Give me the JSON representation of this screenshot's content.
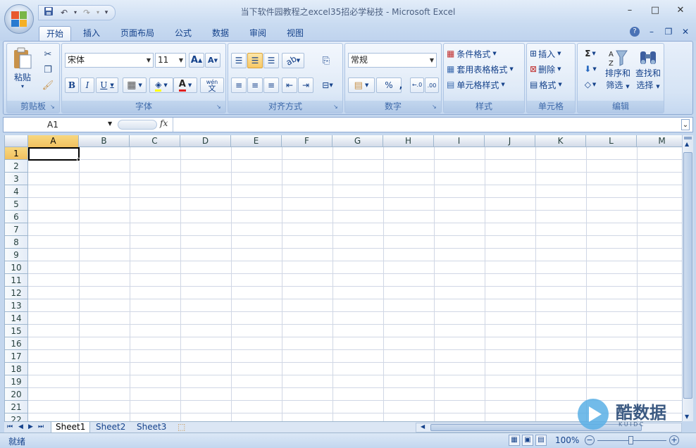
{
  "window": {
    "title": "当下软件园教程之excel35招必学秘技 - Microsoft Excel"
  },
  "qat": {
    "save": "save-icon",
    "undo": "undo-icon",
    "redo": "redo-icon"
  },
  "window_controls": {
    "minimize": "–",
    "maximize": "□",
    "close": "✕"
  },
  "ribbon_tabs": [
    {
      "label": "开始",
      "active": true
    },
    {
      "label": "插入"
    },
    {
      "label": "页面布局"
    },
    {
      "label": "公式"
    },
    {
      "label": "数据"
    },
    {
      "label": "审阅"
    },
    {
      "label": "视图"
    }
  ],
  "help_controls": {
    "help": "?",
    "minimize": "–",
    "restore": "❐",
    "close": "✕"
  },
  "clipboard": {
    "paste": "粘贴",
    "group": "剪贴板"
  },
  "font": {
    "name": "宋体",
    "size": "11",
    "bold": "B",
    "italic": "I",
    "underline": "U",
    "grow": "A",
    "shrink": "A",
    "phonetic_top": "wén",
    "phonetic_bottom": "文",
    "group": "字体"
  },
  "alignment": {
    "group": "对齐方式"
  },
  "number": {
    "format": "常规",
    "percent": "%",
    "comma": ",",
    "inc_decimal": "←.0\n.00",
    "group": "数字"
  },
  "styles": {
    "conditional": "条件格式",
    "table": "套用表格格式",
    "cell": "单元格样式",
    "group": "样式"
  },
  "cells": {
    "insert": "插入",
    "delete": "删除",
    "format": "格式",
    "group": "单元格"
  },
  "editing": {
    "sum": "Σ",
    "sort": "排序和",
    "sort2": "筛选",
    "find": "查找和",
    "find2": "选择",
    "group": "编辑"
  },
  "formula_bar": {
    "name_box": "A1",
    "fx": "fx",
    "value": ""
  },
  "columns": [
    "A",
    "B",
    "C",
    "D",
    "E",
    "F",
    "G",
    "H",
    "I",
    "J",
    "K",
    "L",
    "M"
  ],
  "rows": [
    "1",
    "2",
    "3",
    "4",
    "5",
    "6",
    "7",
    "8",
    "9",
    "10",
    "11",
    "12",
    "13",
    "14",
    "15",
    "16",
    "17",
    "18",
    "19",
    "20",
    "21",
    "22"
  ],
  "sheets": [
    {
      "label": "Sheet1",
      "active": true
    },
    {
      "label": "Sheet2"
    },
    {
      "label": "Sheet3"
    }
  ],
  "status": {
    "text": "就绪",
    "zoom": "100%"
  },
  "watermark": {
    "text": "酷数据",
    "sub": "K U I D C"
  },
  "colors": {
    "accent": "#15428b",
    "selected_header": "#f1c15f"
  }
}
